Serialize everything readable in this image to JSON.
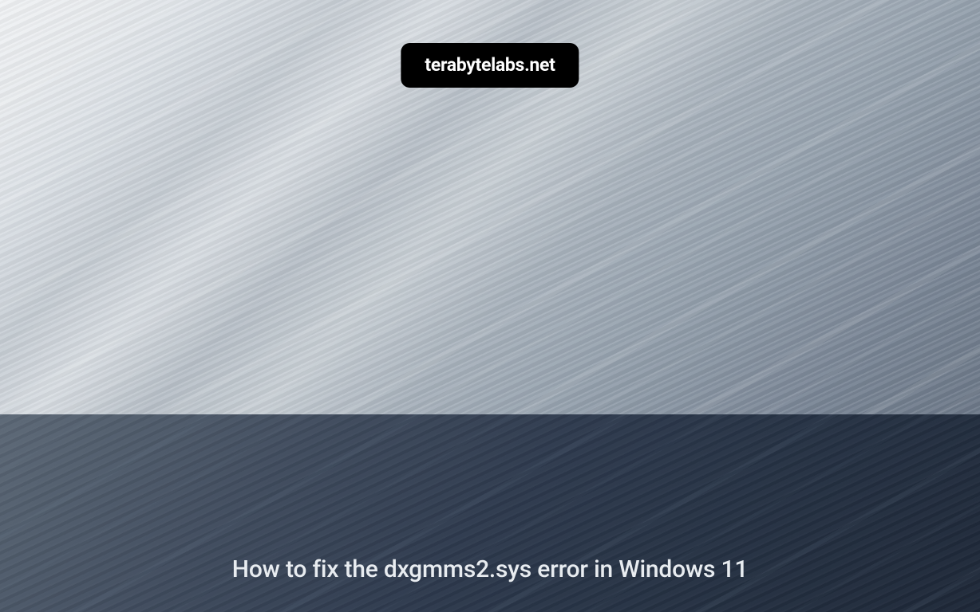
{
  "brand": {
    "name": "terabytelabs.net"
  },
  "article": {
    "title": "How to fix the dxgmms2.sys error in Windows 11"
  }
}
